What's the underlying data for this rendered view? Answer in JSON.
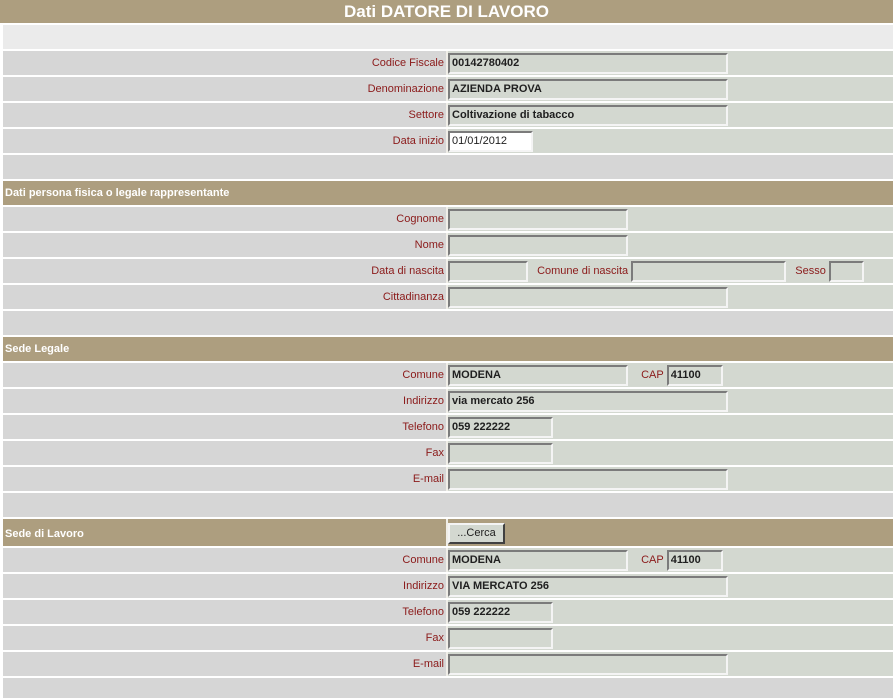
{
  "page": {
    "title": "Dati DATORE DI LAVORO"
  },
  "azienda": {
    "codice_fiscale": {
      "label": "Codice Fiscale",
      "value": "00142780402"
    },
    "denominazione": {
      "label": "Denominazione",
      "value": "AZIENDA PROVA"
    },
    "settore": {
      "label": "Settore",
      "value": "Coltivazione di tabacco"
    },
    "data_inizio": {
      "label": "Data inizio",
      "value": "01/01/2012"
    }
  },
  "persona": {
    "section_title": "Dati persona fisica o legale rappresentante",
    "cognome": {
      "label": "Cognome",
      "value": ""
    },
    "nome": {
      "label": "Nome",
      "value": ""
    },
    "data_nascita": {
      "label": "Data di nascita",
      "value": ""
    },
    "comune_nascita": {
      "label": "Comune di nascita",
      "value": ""
    },
    "sesso": {
      "label": "Sesso",
      "value": ""
    },
    "cittadinanza": {
      "label": "Cittadinanza",
      "value": ""
    }
  },
  "sede_legale": {
    "section_title": "Sede Legale",
    "comune": {
      "label": "Comune",
      "value": "MODENA"
    },
    "cap": {
      "label": "CAP",
      "value": "41100"
    },
    "indirizzo": {
      "label": "Indirizzo",
      "value": "via mercato 256"
    },
    "telefono": {
      "label": "Telefono",
      "value": "059 222222"
    },
    "fax": {
      "label": "Fax",
      "value": ""
    },
    "email": {
      "label": "E-mail",
      "value": ""
    }
  },
  "sede_lavoro": {
    "section_title": "Sede di Lavoro",
    "cerca_button": "...Cerca",
    "comune": {
      "label": "Comune",
      "value": "MODENA"
    },
    "cap": {
      "label": "CAP",
      "value": "41100"
    },
    "indirizzo": {
      "label": "Indirizzo",
      "value": "VIA MERCATO 256"
    },
    "telefono": {
      "label": "Telefono",
      "value": "059 222222"
    },
    "fax": {
      "label": "Fax",
      "value": ""
    },
    "email": {
      "label": "E-mail",
      "value": ""
    }
  },
  "colors": {
    "header_bg": "#ad9e7f",
    "label_text": "#8b1a1a",
    "label_bg": "#d6d6d6",
    "field_bg": "#d3d8d0"
  }
}
